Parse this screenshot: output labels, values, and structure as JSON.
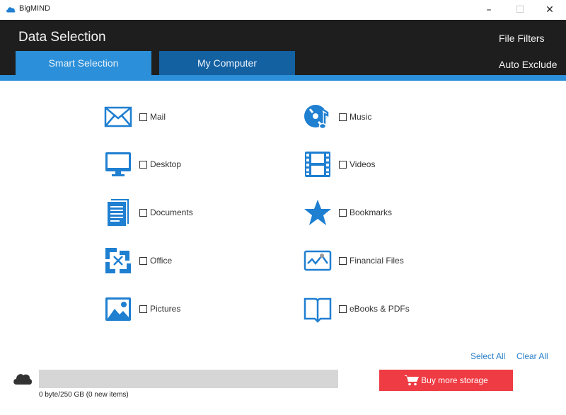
{
  "window": {
    "app_title": "BigMIND",
    "controls": {
      "minimize": "–",
      "maximize": "☐",
      "close": "✕"
    }
  },
  "header": {
    "title": "Data Selection",
    "tabs": [
      {
        "label": "Smart Selection",
        "active": true
      },
      {
        "label": "My Computer",
        "active": false
      }
    ],
    "links": {
      "file_filters": "File Filters",
      "auto_exclude": "Auto Exclude"
    }
  },
  "categories": {
    "left": [
      {
        "label": "Mail",
        "icon": "mail-icon",
        "checked": false
      },
      {
        "label": "Desktop",
        "icon": "desktop-icon",
        "checked": false
      },
      {
        "label": "Documents",
        "icon": "documents-icon",
        "checked": false
      },
      {
        "label": "Office",
        "icon": "office-icon",
        "checked": false
      },
      {
        "label": "Pictures",
        "icon": "pictures-icon",
        "checked": false
      }
    ],
    "right": [
      {
        "label": "Music",
        "icon": "music-icon",
        "checked": false
      },
      {
        "label": "Videos",
        "icon": "videos-icon",
        "checked": false
      },
      {
        "label": "Bookmarks",
        "icon": "bookmark-star-icon",
        "checked": false
      },
      {
        "label": "Financial Files",
        "icon": "financial-chart-icon",
        "checked": false
      },
      {
        "label": "eBooks & PDFs",
        "icon": "ebook-icon",
        "checked": false
      }
    ]
  },
  "actions": {
    "select_all": "Select All",
    "clear_all": "Clear All"
  },
  "storage": {
    "used_fraction": 0,
    "status_text": "0 byte/250 GB (0 new items)",
    "buy_label": "Buy more storage"
  },
  "colors": {
    "accent": "#2b8fd9",
    "tab_inactive": "#1461a2",
    "header_bg": "#1e1e1e",
    "icon_blue": "#1f7fd1",
    "buy_red": "#ef3b43",
    "link_blue": "#2b7fc8"
  }
}
